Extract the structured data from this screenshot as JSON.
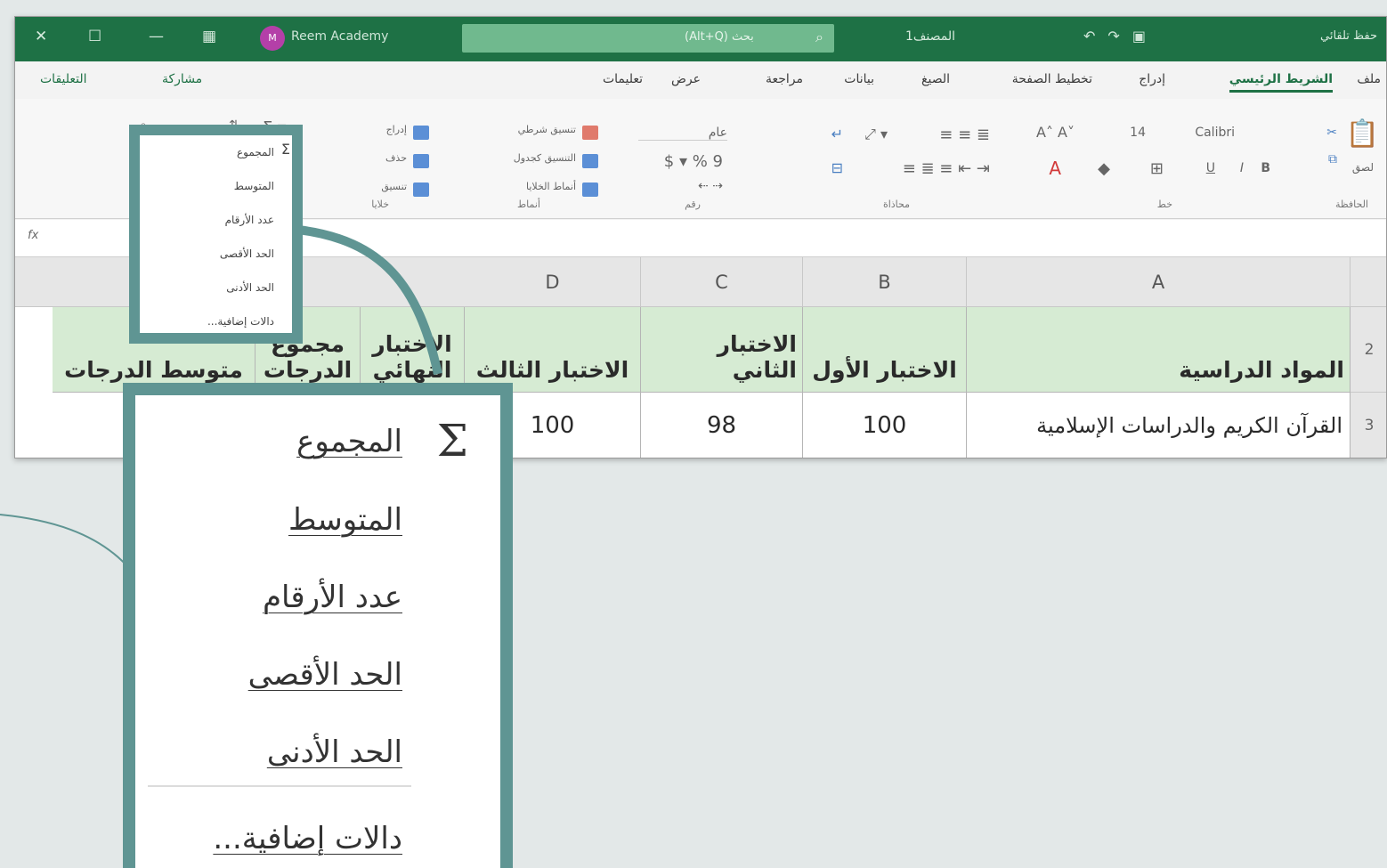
{
  "titlebar": {
    "close_glyph": "✕",
    "max_glyph": "☐",
    "min_glyph": "—",
    "grid_glyph": "▦",
    "avatar_text": "M",
    "user_name": "Reem Academy",
    "search_text": "(Alt+Q) بحث",
    "doc_name": "المصنف1",
    "autosave": "حفظ تلقائي"
  },
  "tabs": {
    "file": "ملف",
    "home": "الشريط الرئيسي",
    "insert": "إدراج",
    "layout": "تخطيط الصفحة",
    "formulas": "الصيغ",
    "data": "بيانات",
    "review": "مراجعة",
    "view": "عرض",
    "help": "تعليمات",
    "share": "مشاركة",
    "comments": "التعليقات"
  },
  "ribbon": {
    "font_name": "Calibri",
    "font_size": "14",
    "number_format": "عام",
    "cond_format": "تنسيق شرطي",
    "format_table": "التنسيق كجدول",
    "cell_styles": "أنماط الخلايا",
    "insert_cells": "إدراج",
    "delete_cells": "حذف",
    "format_cells": "تنسيق",
    "paste": "لصق",
    "groups": {
      "clipboard": "الحافظة",
      "font": "خط",
      "alignment": "محاذاة",
      "number": "رقم",
      "styles": "أنماط",
      "cells": "خلايا"
    }
  },
  "formula_bar": {
    "fx": "fx"
  },
  "grid": {
    "columns": [
      "A",
      "B",
      "C",
      "D"
    ],
    "rows": [
      "2",
      "3"
    ],
    "headers": {
      "subjects": "المواد الدراسية",
      "test1": "الاختبار الأول",
      "test2": "الاختبار الثاني",
      "test3": "الاختبار الثالث",
      "test_final_a": "الاختبار",
      "test_final_b": "النهائي",
      "total_a": "مجموع",
      "total_b": "الدرجات",
      "average": "متوسط الدرجات"
    },
    "row3": {
      "subject": "القرآن الكريم والدراسات الإسلامية",
      "test1": "100",
      "test2": "98",
      "test3": "100"
    }
  },
  "mini_menu": [
    "المجموع",
    "المتوسط",
    "عدد الأرقام",
    "الحد الأقصى",
    "الحد الأدنى",
    "دالات إضافية..."
  ],
  "menu": {
    "sigma": "Σ",
    "sum": "المجموع",
    "average": "المتوسط",
    "count": "عدد الأرقام",
    "max": "الحد الأقصى",
    "min": "الحد الأدنى",
    "more": "دالات إضافية..."
  },
  "colors": {
    "excel_green": "#1e7145",
    "callout_teal": "#5f9593",
    "header_fill": "#d6ebd3"
  }
}
